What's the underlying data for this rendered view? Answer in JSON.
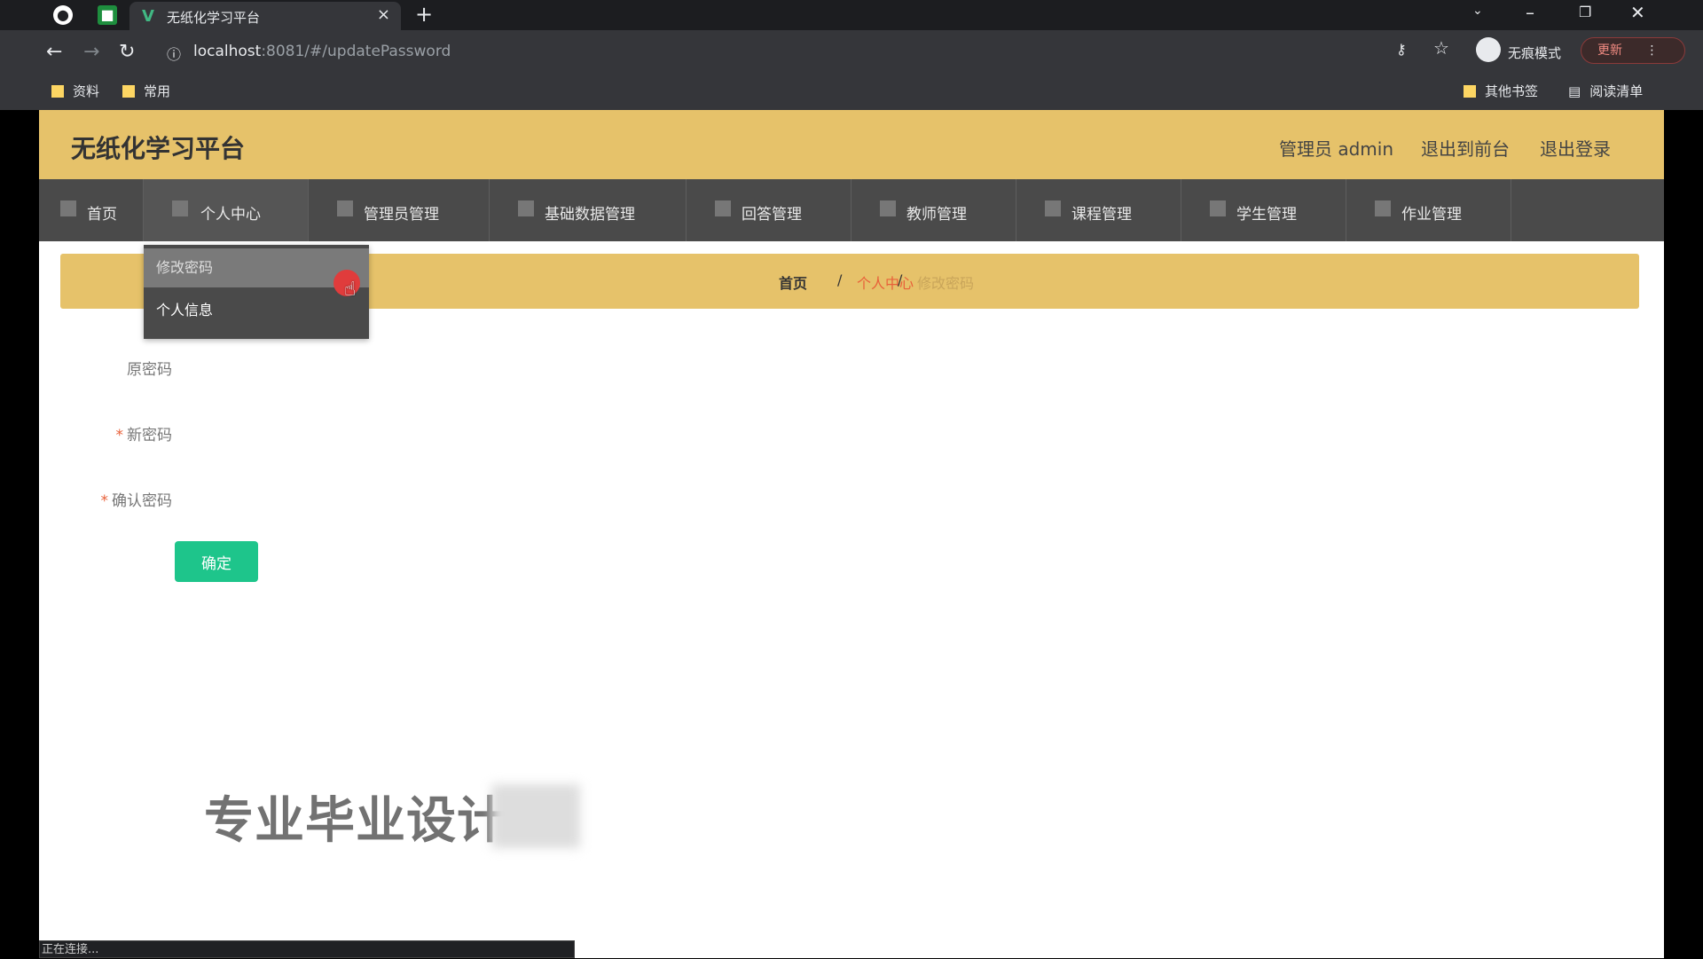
{
  "browser": {
    "tab_title": "无纸化学习平台",
    "tab_close": "×",
    "new_tab": "+",
    "url_host": "localhost",
    "url_rest": ":8081/#/updatePassword",
    "incognito_label": "无痕模式",
    "update_label": "更新",
    "bookmarks": [
      "资料",
      "常用"
    ],
    "bookmarks_right": [
      "其他书签",
      "阅读清单"
    ],
    "status_text": "正在连接..."
  },
  "app": {
    "brand": "无纸化学习平台",
    "user": "管理员 admin",
    "exit_front": "退出到前台",
    "logout": "退出登录"
  },
  "menu": [
    {
      "label": "首页"
    },
    {
      "label": "个人中心"
    },
    {
      "label": "管理员管理"
    },
    {
      "label": "基础数据管理"
    },
    {
      "label": "回答管理"
    },
    {
      "label": "教师管理"
    },
    {
      "label": "课程管理"
    },
    {
      "label": "学生管理"
    },
    {
      "label": "作业管理"
    }
  ],
  "dropdown": {
    "item1": "修改密码",
    "item2": "个人信息"
  },
  "breadcrumb": {
    "home": "首页",
    "sep": "/",
    "level1": "个人中心",
    "level2": "修改密码"
  },
  "form": {
    "old_password": "原密码",
    "new_password": "新密码",
    "confirm_password": "确认密码",
    "submit": "确定"
  },
  "watermark": "专业毕业设计"
}
